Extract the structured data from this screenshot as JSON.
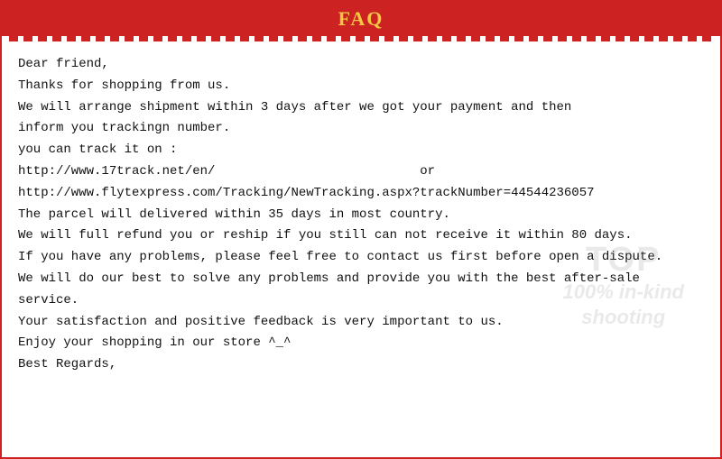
{
  "header": {
    "title": "FAQ"
  },
  "content": {
    "line1": "Dear friend,",
    "line2": "Thanks for shopping from us.",
    "line3": "We will arrange shipment within 3 days after we got your payment and then",
    "line4": "inform you trackingn number.",
    "line5": "you can track it on :",
    "line6": "http://www.17track.net/en/",
    "line6_or": "or",
    "line7": "http://www.flytexpress.com/Tracking/NewTracking.aspx?trackNumber=44544236057",
    "line8": "The parcel will delivered within 35 days in most country.",
    "line9": "We will full refund you or reship if you still can not receive it within 80 days.",
    "line10": "If you have any problems, please feel free to contact us first before open a dispute.",
    "line11": "We will do our best to solve any problems and provide you with the best after-sale",
    "line12": "service.",
    "line13": "Your satisfaction and positive feedback is very important to us.",
    "line14": "Enjoy your shopping in our store ^_^",
    "line15": "Best Regards,"
  },
  "watermark": {
    "top": "TOP",
    "bottom_line1": "100% in-kind",
    "bottom_line2": "shooting"
  }
}
